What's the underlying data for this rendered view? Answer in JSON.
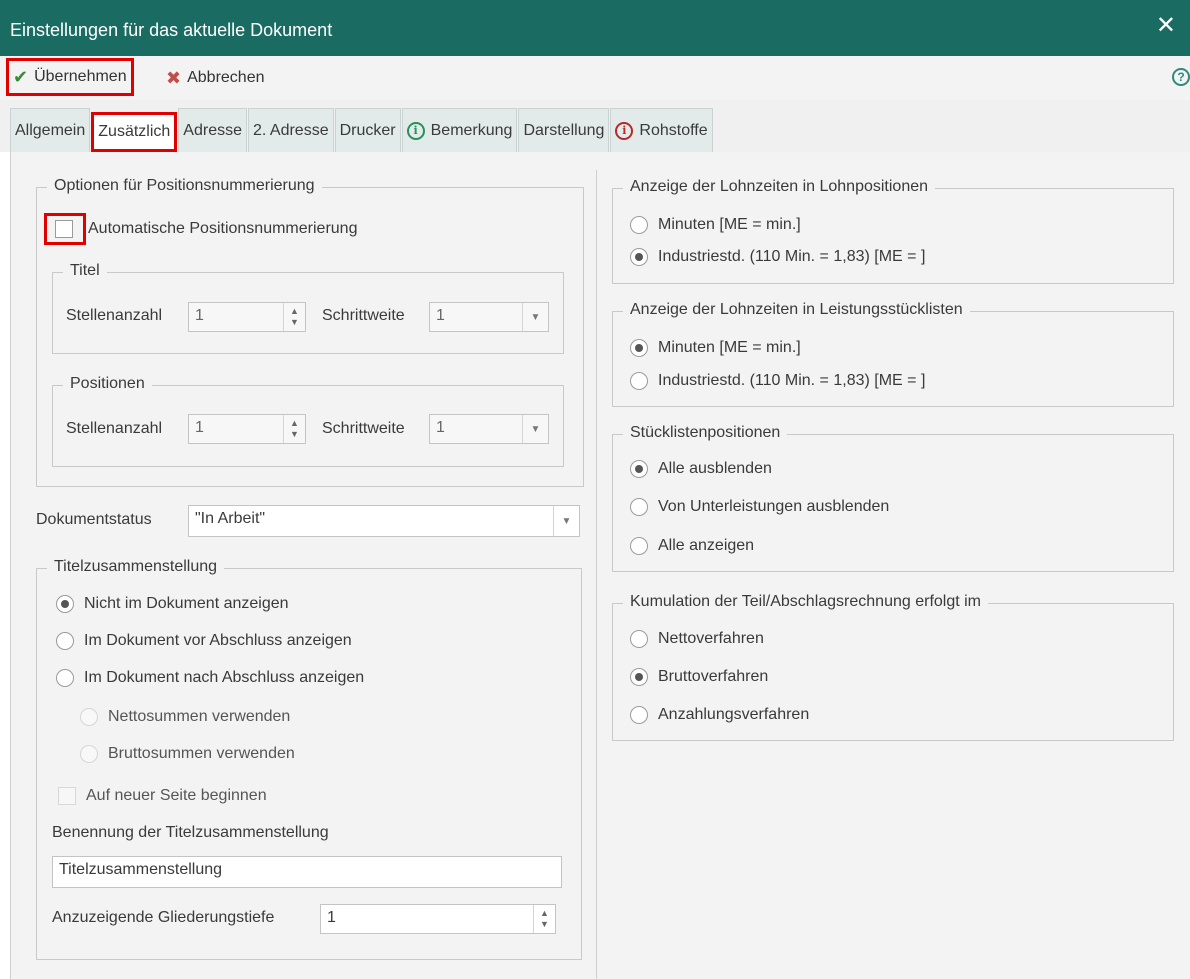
{
  "window": {
    "title": "Einstellungen für das aktuelle Dokument"
  },
  "toolbar": {
    "apply_label": "Übernehmen",
    "cancel_label": "Abbrechen"
  },
  "tabs": [
    "Allgemein",
    "Zusätzlich",
    "Adresse",
    "2. Adresse",
    "Drucker",
    "Bemerkung",
    "Darstellung",
    "Rohstoffe"
  ],
  "position_numbering": {
    "legend": "Optionen für Positionsnummerierung",
    "auto_label": "Automatische Positionsnummerierung",
    "auto_checked": false,
    "titel": {
      "legend": "Titel",
      "digits_label": "Stellenanzahl",
      "digits_value": "1",
      "step_label": "Schrittweite",
      "step_value": "1"
    },
    "positionen": {
      "legend": "Positionen",
      "digits_label": "Stellenanzahl",
      "digits_value": "1",
      "step_label": "Schrittweite",
      "step_value": "1"
    }
  },
  "document_status": {
    "label": "Dokumentstatus",
    "value": "\"In Arbeit\""
  },
  "title_summary": {
    "legend": "Titelzusammenstellung",
    "options": [
      "Nicht im Dokument anzeigen",
      "Im Dokument vor Abschluss anzeigen",
      "Im Dokument nach Abschluss anzeigen"
    ],
    "selected": 0,
    "sub_options": [
      "Nettosummen verwenden",
      "Bruttosummen verwenden"
    ],
    "new_page_label": "Auf neuer Seite beginnen",
    "name_label": "Benennung der Titelzusammenstellung",
    "name_value": "Titelzusammenstellung",
    "depth_label": "Anzuzeigende Gliederungstiefe",
    "depth_value": "1"
  },
  "labor_positions": {
    "legend": "Anzeige der Lohnzeiten in Lohnpositionen",
    "options": [
      "Minuten  [ME = min.]",
      "Industriestd. (110 Min. = 1,83)  [ME = ]"
    ],
    "selected": 1
  },
  "labor_bom": {
    "legend": "Anzeige der Lohnzeiten in Leistungsstücklisten",
    "options": [
      "Minuten  [ME = min.]",
      "Industriestd. (110 Min. = 1,83)  [ME = ]"
    ],
    "selected": 0
  },
  "bom_positions": {
    "legend": "Stücklistenpositionen",
    "options": [
      "Alle ausblenden",
      "Von Unterleistungen ausblenden",
      "Alle anzeigen"
    ],
    "selected": 0
  },
  "cumulation": {
    "legend": "Kumulation der Teil/Abschlagsrechnung erfolgt im",
    "options": [
      "Nettoverfahren",
      "Bruttoverfahren",
      "Anzahlungsverfahren"
    ],
    "selected": 1
  },
  "colors": {
    "titlebar": "#1a6c63",
    "highlight": "#e00000",
    "check": "#3a8a3a",
    "cancel": "#c0504d"
  }
}
